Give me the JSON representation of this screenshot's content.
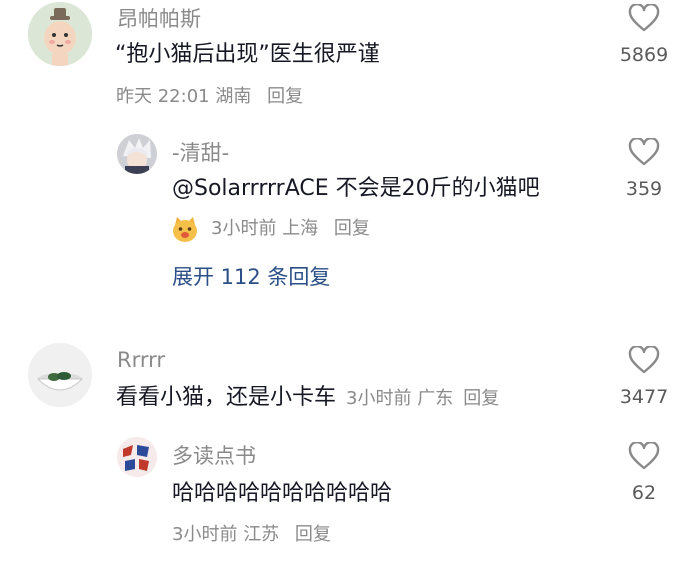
{
  "comments": [
    {
      "username": "昂帕帕斯",
      "text": "“抱小猫后出现”医生很严谨",
      "time": "昨天 22:01",
      "location": "湖南",
      "reply_label": "回复",
      "likes": "5869",
      "avatar_icon": "cartoon-avatar"
    },
    {
      "username": "-清甜-",
      "text": "@SolarrrrrACE 不会是20斤的小猫吧",
      "badge_icon": "cat-face-emoji",
      "time": "3小时前",
      "location": "上海",
      "reply_label": "回复",
      "likes": "359",
      "avatar_icon": "anime-avatar"
    },
    {
      "username": "Rrrrr",
      "text": "看看小猫，还是小卡车",
      "time": "3小时前",
      "location": "广东",
      "reply_label": "回复",
      "likes": "3477",
      "avatar_icon": "bowl-avatar"
    },
    {
      "username": "多读点书",
      "text": "哈哈哈哈哈哈哈哈哈哈",
      "time": "3小时前",
      "location": "江苏",
      "reply_label": "回复",
      "likes": "62",
      "avatar_icon": "text-avatar"
    }
  ],
  "expand_replies": "展开 112 条回复",
  "colors": {
    "username": "#8a8a8a",
    "text": "#161823",
    "link": "#2a4e86",
    "heart": "#8a8a8a"
  }
}
